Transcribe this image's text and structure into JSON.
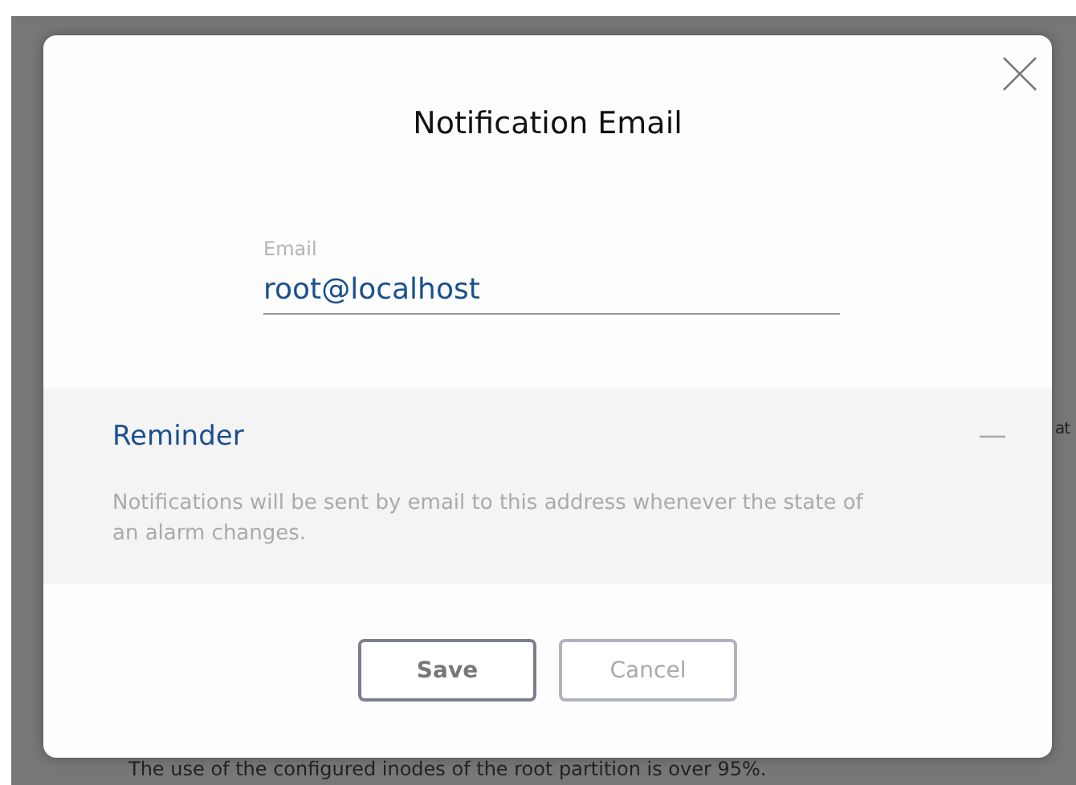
{
  "background": {
    "texts": [
      "at",
      "The use of the configured inodes of the root partition is over 95%."
    ]
  },
  "dialog": {
    "title": "Notification Email",
    "email": {
      "label": "Email",
      "value": "root@localhost"
    },
    "reminder": {
      "title": "Reminder",
      "expanded": true,
      "text": "Notifications will be sent by email to this address whenever the state of an alarm changes."
    },
    "buttons": [
      {
        "label": "Save",
        "disabled": false
      },
      {
        "label": "Cancel",
        "disabled": true
      }
    ]
  }
}
